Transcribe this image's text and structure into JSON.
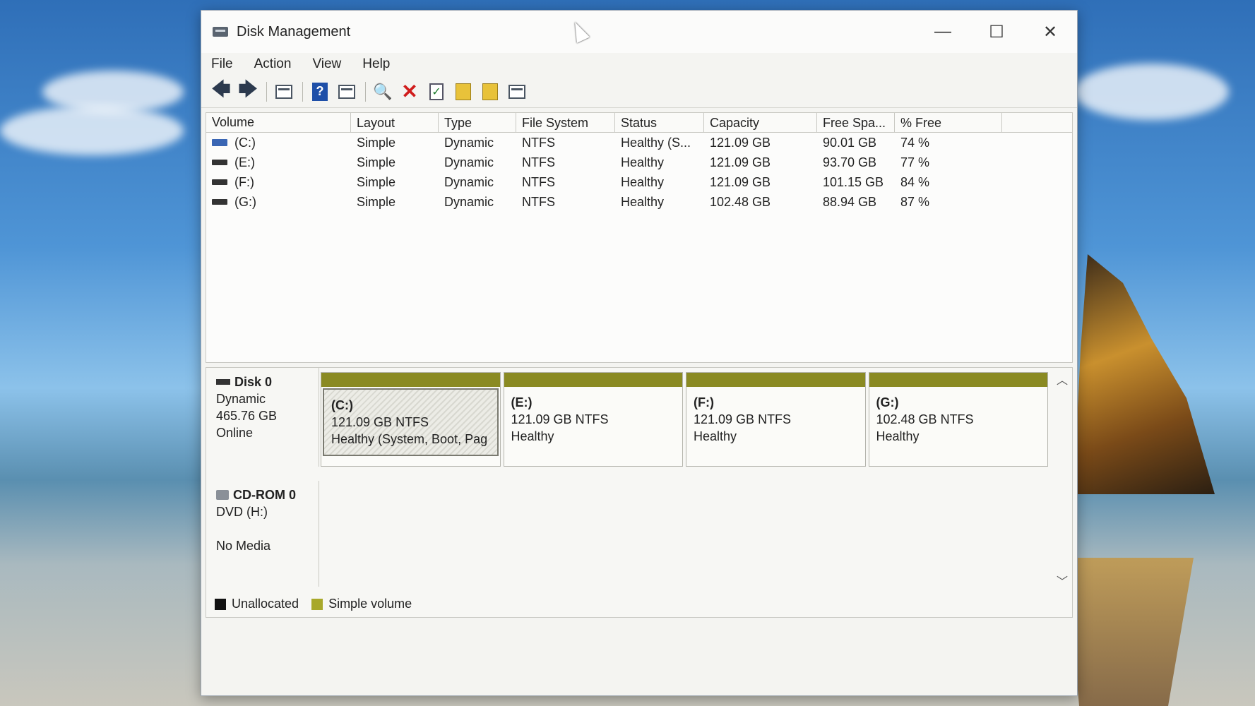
{
  "window": {
    "title": "Disk Management",
    "controls": {
      "minimize": "—",
      "maximize": "☐",
      "close": "✕"
    }
  },
  "menu": [
    "File",
    "Action",
    "View",
    "Help"
  ],
  "toolbar": {
    "back": "🡄",
    "forward": "🡆",
    "delete": "✕",
    "check": "✓",
    "search": "🔍"
  },
  "table": {
    "headers": [
      "Volume",
      "Layout",
      "Type",
      "File System",
      "Status",
      "Capacity",
      "Free Spa...",
      "% Free"
    ],
    "rows": [
      {
        "volume": "(C:)",
        "layout": "Simple",
        "type": "Dynamic",
        "fs": "NTFS",
        "status": "Healthy (S...",
        "capacity": "121.09 GB",
        "free": "90.01 GB",
        "pct": "74 %"
      },
      {
        "volume": "(E:)",
        "layout": "Simple",
        "type": "Dynamic",
        "fs": "NTFS",
        "status": "Healthy",
        "capacity": "121.09 GB",
        "free": "93.70 GB",
        "pct": "77 %"
      },
      {
        "volume": "(F:)",
        "layout": "Simple",
        "type": "Dynamic",
        "fs": "NTFS",
        "status": "Healthy",
        "capacity": "121.09 GB",
        "free": "101.15 GB",
        "pct": "84 %"
      },
      {
        "volume": "(G:)",
        "layout": "Simple",
        "type": "Dynamic",
        "fs": "NTFS",
        "status": "Healthy",
        "capacity": "102.48 GB",
        "free": "88.94 GB",
        "pct": "87 %"
      }
    ]
  },
  "disk0": {
    "name": "Disk 0",
    "type": "Dynamic",
    "size": "465.76 GB",
    "state": "Online",
    "partitions": [
      {
        "name": "(C:)",
        "size": "121.09 GB NTFS",
        "status": "Healthy (System, Boot, Pag"
      },
      {
        "name": "(E:)",
        "size": "121.09 GB NTFS",
        "status": "Healthy"
      },
      {
        "name": "(F:)",
        "size": "121.09 GB NTFS",
        "status": "Healthy"
      },
      {
        "name": "(G:)",
        "size": "102.48 GB NTFS",
        "status": "Healthy"
      }
    ]
  },
  "cdrom0": {
    "name": "CD-ROM 0",
    "drive": "DVD (H:)",
    "media": "No Media"
  },
  "legend": {
    "unallocated": "Unallocated",
    "simple": "Simple volume",
    "unallocated_color": "#111111",
    "simple_color": "#a8a82a"
  },
  "colors": {
    "partition_bar": "#8a8a22",
    "system_drive": "#3a66b4"
  }
}
